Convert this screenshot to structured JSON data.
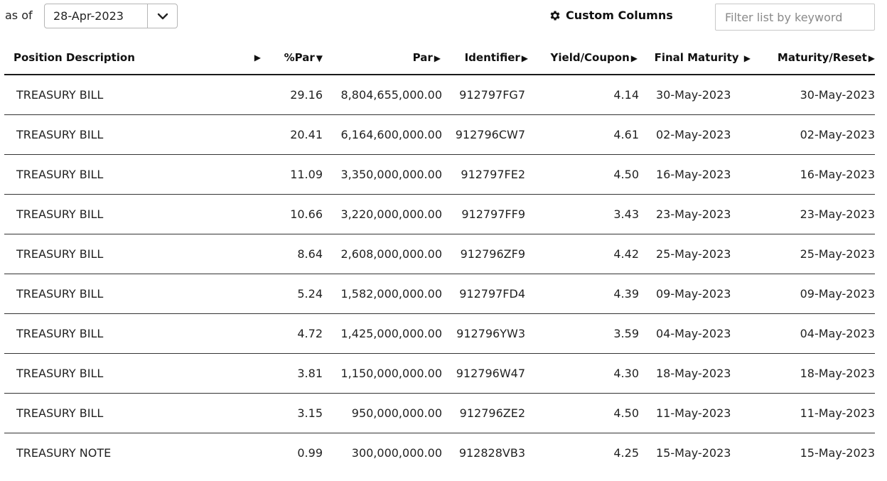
{
  "toolbar": {
    "as_of_label": "as of",
    "date_value": "28-Apr-2023",
    "custom_columns_label": "Custom Columns",
    "filter_placeholder": "Filter list by keyword"
  },
  "table": {
    "headers": {
      "description": "Position Description",
      "pct_par": "%Par",
      "par": "Par",
      "identifier": "Identifier",
      "yield": "Yield/Coupon",
      "final_maturity": "Final Maturity",
      "maturity_reset": "Maturity/Reset"
    },
    "rows": [
      {
        "description": "TREASURY BILL",
        "pct_par": "29.16",
        "par": "8,804,655,000.00",
        "identifier": "912797FG7",
        "yield": "4.14",
        "final_maturity": "30-May-2023",
        "maturity_reset": "30-May-2023"
      },
      {
        "description": "TREASURY BILL",
        "pct_par": "20.41",
        "par": "6,164,600,000.00",
        "identifier": "912796CW7",
        "yield": "4.61",
        "final_maturity": "02-May-2023",
        "maturity_reset": "02-May-2023"
      },
      {
        "description": "TREASURY BILL",
        "pct_par": "11.09",
        "par": "3,350,000,000.00",
        "identifier": "912797FE2",
        "yield": "4.50",
        "final_maturity": "16-May-2023",
        "maturity_reset": "16-May-2023"
      },
      {
        "description": "TREASURY BILL",
        "pct_par": "10.66",
        "par": "3,220,000,000.00",
        "identifier": "912797FF9",
        "yield": "3.43",
        "final_maturity": "23-May-2023",
        "maturity_reset": "23-May-2023"
      },
      {
        "description": "TREASURY BILL",
        "pct_par": "8.64",
        "par": "2,608,000,000.00",
        "identifier": "912796ZF9",
        "yield": "4.42",
        "final_maturity": "25-May-2023",
        "maturity_reset": "25-May-2023"
      },
      {
        "description": "TREASURY BILL",
        "pct_par": "5.24",
        "par": "1,582,000,000.00",
        "identifier": "912797FD4",
        "yield": "4.39",
        "final_maturity": "09-May-2023",
        "maturity_reset": "09-May-2023"
      },
      {
        "description": "TREASURY BILL",
        "pct_par": "4.72",
        "par": "1,425,000,000.00",
        "identifier": "912796YW3",
        "yield": "3.59",
        "final_maturity": "04-May-2023",
        "maturity_reset": "04-May-2023"
      },
      {
        "description": "TREASURY BILL",
        "pct_par": "3.81",
        "par": "1,150,000,000.00",
        "identifier": "912796W47",
        "yield": "4.30",
        "final_maturity": "18-May-2023",
        "maturity_reset": "18-May-2023"
      },
      {
        "description": "TREASURY BILL",
        "pct_par": "3.15",
        "par": "950,000,000.00",
        "identifier": "912796ZE2",
        "yield": "4.50",
        "final_maturity": "11-May-2023",
        "maturity_reset": "11-May-2023"
      },
      {
        "description": "TREASURY NOTE",
        "pct_par": "0.99",
        "par": "300,000,000.00",
        "identifier": "912828VB3",
        "yield": "4.25",
        "final_maturity": "15-May-2023",
        "maturity_reset": "15-May-2023"
      }
    ]
  }
}
